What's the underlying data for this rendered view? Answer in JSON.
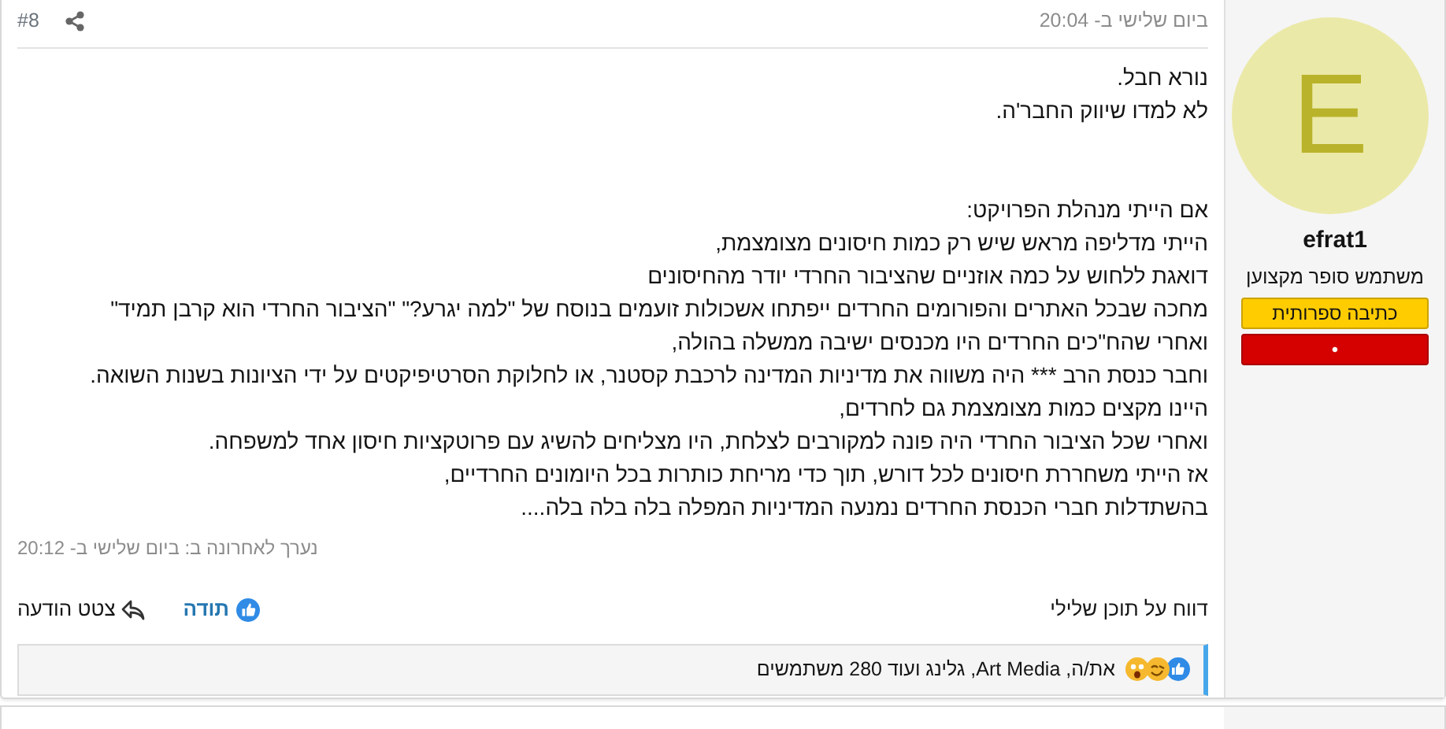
{
  "post": {
    "date": "ביום שלישי ב- 20:04",
    "number": "#8",
    "paragraphs": [
      [
        "נורא חבל.",
        "לא למדו שיווק החבר'ה."
      ],
      [
        "אם הייתי מנהלת הפרויקט:",
        "הייתי מדליפה מראש שיש רק כמות חיסונים מצומצמת,",
        "דואגת ללחוש על כמה אוזניים שהציבור החרדי יודר מהחיסונים",
        "מחכה שבכל האתרים והפורומים החרדים ייפתחו אשכולות זועמים בנוסח של \"למה יגרע?\" \"הציבור החרדי הוא קרבן תמיד\"",
        "ואחרי שהח\"כים החרדים היו מכנסים ישיבה ממשלה בהולה,",
        "וחבר כנסת הרב *** היה משווה את מדיניות המדינה לרכבת קסטנר, או לחלוקת הסרטיפיקטים על ידי הציונות בשנות השואה.",
        "היינו מקצים כמות מצומצמת גם לחרדים,",
        "ואחרי שכל הציבור החרדי היה פונה למקורבים לצלחת, היו מצליחים להשיג עם פרוטקציות חיסון אחד למשפחה.",
        "אז הייתי משחררת חיסונים לכל דורש, תוך כדי מריחת כותרות בכל היומונים החרדיים,",
        "בהשתדלות חברי הכנסת החרדים נמנעה המדיניות המפלה בלה בלה בלה...."
      ]
    ],
    "edited": "נערך לאחרונה ב: ביום שלישי ב- 20:12",
    "report": "דווח על תוכן שלילי",
    "like": "תודה",
    "quote": "צטט הודעה",
    "reactions": "את/ה, Art Media, גלינג ועוד 280 משתמשים"
  },
  "user": {
    "avatar_letter": "E",
    "name": "efrat1",
    "title": "משתמש סופר מקצוען",
    "banners": [
      {
        "text": "כתיבה ספרותית",
        "color": "#ffcc00"
      },
      {
        "text": "•",
        "color": "#d50000"
      }
    ]
  }
}
